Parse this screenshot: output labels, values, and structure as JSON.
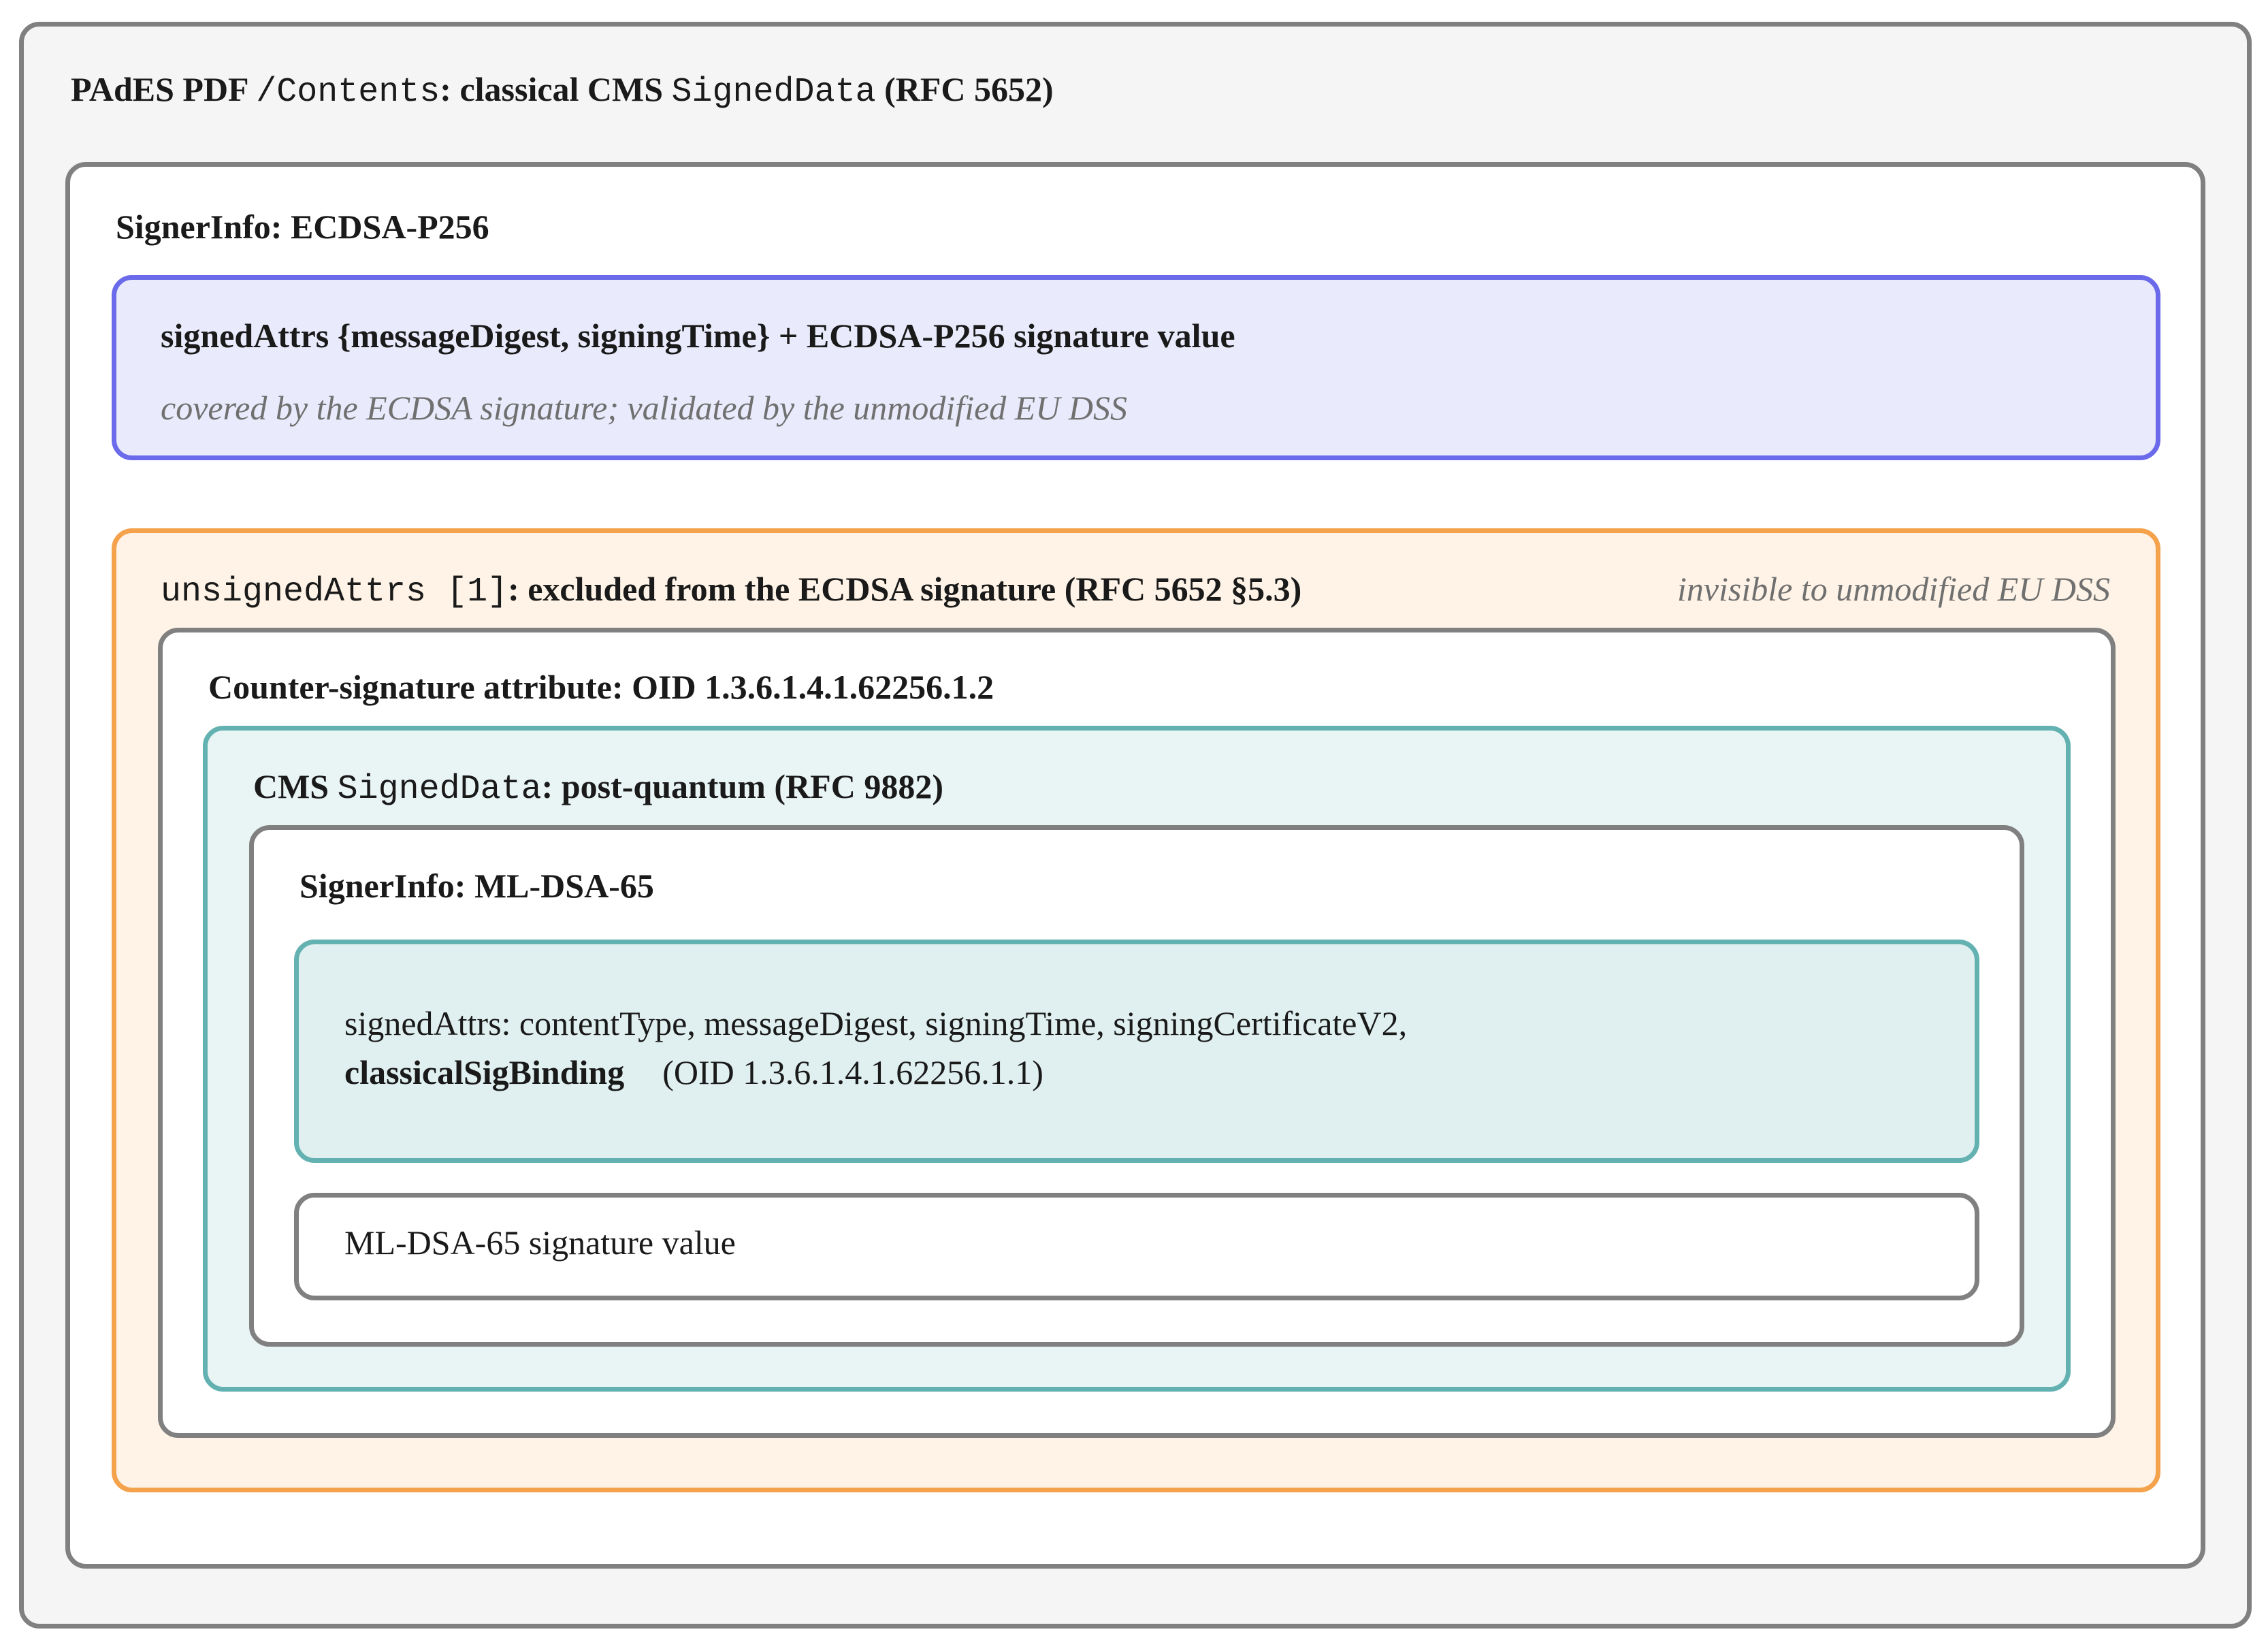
{
  "colors": {
    "outer_border": "#808080",
    "ecdsa_border": "#6a6aea",
    "ecdsa_fill": "#e9eafb",
    "unsigned_border": "#f4a24c",
    "unsigned_fill": "#fef3e6",
    "pq_border": "#63b1b1",
    "pq_fill": "#e9f4f4"
  },
  "outer": {
    "title_1": "PAdES PDF ",
    "title_code_1": "/Contents",
    "title_2": ": classical CMS ",
    "title_code_2": "SignedData",
    "title_3": " (RFC 5652)"
  },
  "signer_info": {
    "title": "SignerInfo: ECDSA-P256"
  },
  "ecdsa_box": {
    "title": "signedAttrs {messageDigest, signingTime} + ECDSA-P256 signature value",
    "note": "covered by the ECDSA signature; validated by the unmodified EU DSS"
  },
  "unsigned_box": {
    "title_code": "unsignedAttrs [1]",
    "title": ": excluded from the ECDSA signature (RFC 5652 §5.3)",
    "note": "invisible to unmodified EU DSS"
  },
  "countersig_box": {
    "title": "Counter-signature attribute: OID 1.3.6.1.4.1.62256.1.2"
  },
  "cms_pq_box": {
    "title_1": "CMS ",
    "title_code": "SignedData",
    "title_2": ": post-quantum (RFC 9882)"
  },
  "ml_dsa_signer": {
    "title": "SignerInfo: ML-DSA-65"
  },
  "pq_signed_attrs": {
    "line_1": "signedAttrs: contentType, messageDigest, signingTime, signingCertificateV2,",
    "line_2_bold": "classicalSigBinding",
    "line_2_rest": "(OID 1.3.6.1.4.1.62256.1.1)"
  },
  "pq_signature": {
    "label": "ML-DSA-65 signature value"
  }
}
